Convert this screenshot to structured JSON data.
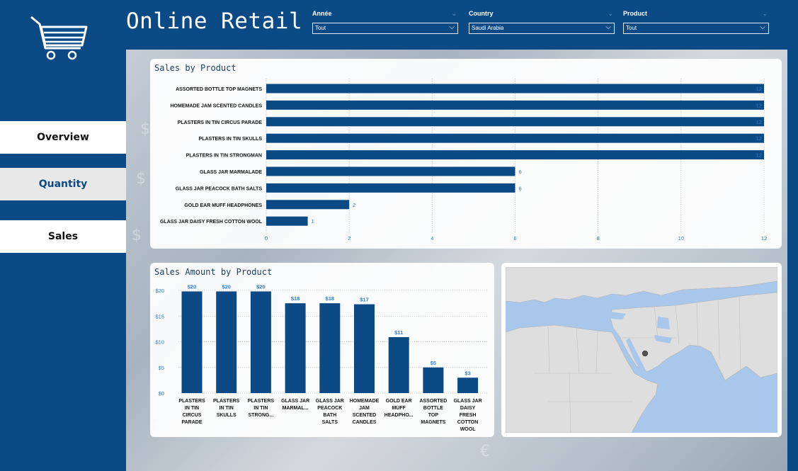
{
  "app": {
    "title": "Online Retail"
  },
  "sidebar": {
    "logo_icon": "shopping-cart-icon",
    "nav": [
      {
        "label": "Overview"
      },
      {
        "label": "Quantity"
      },
      {
        "label": "Sales"
      }
    ]
  },
  "filters": {
    "year": {
      "label": "Année",
      "value": "Tout"
    },
    "country": {
      "label": "Country",
      "value": "Saudi Arabia"
    },
    "product": {
      "label": "Product",
      "value": "Tout"
    }
  },
  "colors": {
    "accent": "#0c4a86",
    "bar": "#0c4a86",
    "label_blue": "#2f7fd0"
  },
  "chart_data": [
    {
      "type": "bar",
      "orientation": "horizontal",
      "title": "Sales by Product",
      "categories": [
        "ASSORTED BOTTLE TOP MAGNETS",
        "HOMEMADE JAM SCENTED CANDLES",
        "PLASTERS IN TIN CIRCUS PARADE",
        "PLASTERS IN TIN SKULLS",
        "PLASTERS IN TIN STRONGMAN",
        "GLASS JAR MARMALADE",
        "GLASS JAR PEACOCK BATH SALTS",
        "GOLD EAR MUFF HEADPHONES",
        "GLASS JAR DAISY FRESH COTTON WOOL"
      ],
      "values": [
        12,
        12,
        12,
        12,
        12,
        6,
        6,
        2,
        1
      ],
      "value_labels": [
        "12",
        "12",
        "12",
        "12",
        "12",
        "6",
        "6",
        "2",
        "1"
      ],
      "xticks": [
        "0",
        "2",
        "4",
        "6",
        "8",
        "10",
        "12"
      ],
      "xlim": [
        0,
        12
      ],
      "grid": true
    },
    {
      "type": "bar",
      "title": "Sales Amount by Product",
      "categories": [
        [
          "PLASTERS",
          "IN TIN",
          "CIRCUS",
          "PARADE"
        ],
        [
          "PLASTERS",
          "IN TIN",
          "SKULLS"
        ],
        [
          "PLASTERS",
          "IN TIN",
          "STRONG..."
        ],
        [
          "GLASS JAR",
          "MARMAL..."
        ],
        [
          "GLASS JAR",
          "PEACOCK",
          "BATH",
          "SALTS"
        ],
        [
          "HOMEMADE",
          "JAM",
          "SCENTED",
          "CANDLES"
        ],
        [
          "GOLD EAR",
          "MUFF",
          "HEADPHO..."
        ],
        [
          "ASSORTED",
          "BOTTLE",
          "TOP",
          "MAGNETS"
        ],
        [
          "GLASS JAR",
          "DAISY",
          "FRESH",
          "COTTON",
          "WOOL"
        ]
      ],
      "values": [
        19.8,
        19.8,
        19.8,
        17.5,
        17.5,
        17.3,
        10.9,
        5.0,
        3.0
      ],
      "value_labels": [
        "$20",
        "$20",
        "$20",
        "$18",
        "$18",
        "$17",
        "$11",
        "$5",
        "$3"
      ],
      "yticks": [
        "$0",
        "$5",
        "$10",
        "$15",
        "$20"
      ],
      "ylim": [
        0,
        20
      ],
      "grid": true
    }
  ],
  "map": {
    "marker_country": "Saudi Arabia"
  }
}
